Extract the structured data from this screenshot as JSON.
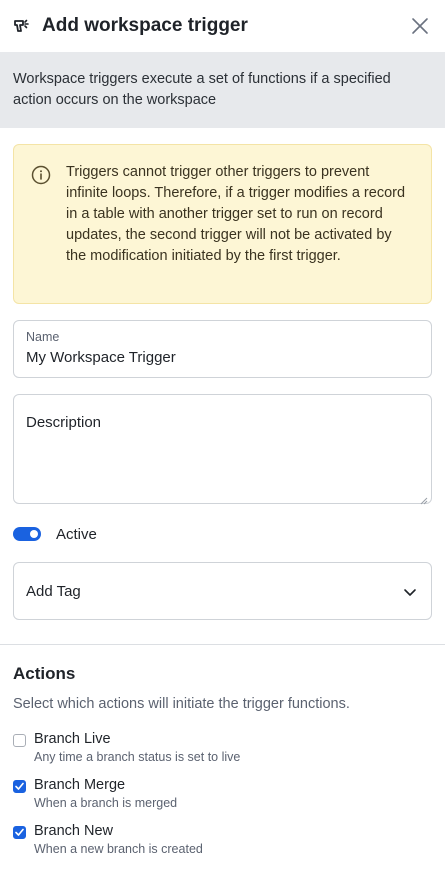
{
  "header": {
    "title": "Add workspace trigger",
    "icon": "trigger-icon",
    "close_icon": "close-icon"
  },
  "intro": {
    "text": "Workspace triggers execute a set of functions if a specified action occurs on the workspace"
  },
  "warning": {
    "icon": "info-icon",
    "text": "Triggers cannot trigger other triggers to prevent infinite loops. Therefore, if a trigger modifies a record in a table with another trigger set to run on record updates, the second trigger will not be activated by the modification initiated by the first trigger.",
    "background": "#fdf6d5"
  },
  "form": {
    "name_label": "Name",
    "name_value": "My Workspace Trigger",
    "description_placeholder": "Description",
    "active_label": "Active",
    "active_on": true,
    "tag_placeholder": "Add Tag",
    "accent": "#1a62e0"
  },
  "actions": {
    "heading": "Actions",
    "subtitle": "Select which actions will initiate the trigger functions.",
    "items": [
      {
        "label": "Branch Live",
        "desc": "Any time a branch status is set to live",
        "checked": false
      },
      {
        "label": "Branch Merge",
        "desc": "When a branch is merged",
        "checked": true
      },
      {
        "label": "Branch New",
        "desc": "When a new branch is created",
        "checked": true
      }
    ]
  }
}
